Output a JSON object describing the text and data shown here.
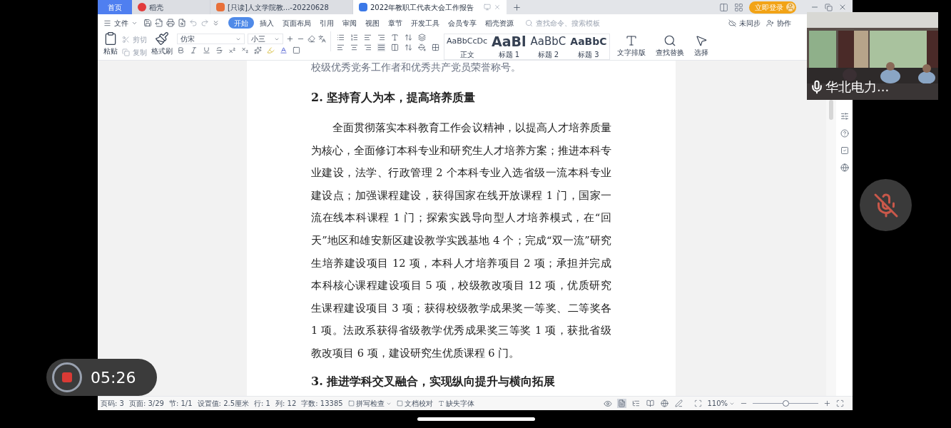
{
  "app_tabs": [
    {
      "label": "首页",
      "kind": "home",
      "selected": false
    },
    {
      "label": "稻壳",
      "kind": "app",
      "selected": false
    },
    {
      "label": "[只读]人文学院教...-20220628",
      "kind": "slides",
      "selected": false
    },
    {
      "label": "2022年教职工代表大会工作报告",
      "kind": "doc",
      "selected": true
    }
  ],
  "login_button": "立即登录",
  "menu": {
    "file": "文件",
    "tabs": [
      {
        "label": "开始",
        "selected": true
      },
      {
        "label": "插入",
        "selected": false
      },
      {
        "label": "页面布局",
        "selected": false
      },
      {
        "label": "引用",
        "selected": false
      },
      {
        "label": "审阅",
        "selected": false
      },
      {
        "label": "视图",
        "selected": false
      },
      {
        "label": "章节",
        "selected": false
      },
      {
        "label": "开发工具",
        "selected": false
      },
      {
        "label": "会员专享",
        "selected": false
      },
      {
        "label": "稻壳资源",
        "selected": false
      }
    ],
    "search": {
      "placeholder": "查找命令、搜索模板"
    },
    "sync": "未同步",
    "collab": "协作"
  },
  "ribbon": {
    "paste": "粘贴",
    "cut": {
      "label": "剪切",
      "disabled": true
    },
    "copy": {
      "label": "复制",
      "disabled": true
    },
    "format_painter": "格式刷",
    "font": "仿宋",
    "size": "小三",
    "styles": [
      {
        "preview": "AaBbCcDc",
        "label": "正文",
        "kind": "normal"
      },
      {
        "preview": "AaBl",
        "label": "标题 1",
        "kind": "h1"
      },
      {
        "preview": "AaBbC",
        "label": "标题 2",
        "kind": "h2"
      },
      {
        "preview": "AaBbC",
        "label": "标题 3",
        "kind": "h3"
      }
    ],
    "text_layout": "文字排版",
    "find_replace": "查找替换",
    "select": "选择"
  },
  "document": {
    "blocks": [
      {
        "kind": "clipped",
        "text": "校级优秀党务工作者和优秀共产党员荣誉称号。"
      },
      {
        "kind": "heading",
        "text": "2. 坚持育人为本，提高培养质量"
      },
      {
        "kind": "body",
        "text": "全面贯彻落实本科教育工作会议精神，以提高人才培养质量为核心，全面修订本科专业和研究生人才培养方案；推进本科专业建设，法学、行政管理 2 个本科专业入选省级一流本科专业建设点；加强课程建设，获得国家在线开放课程 1 门，国家一流在线本科课程 1 门；探索实践导向型人才培养模式，在“回天”地区和雄安新区建设教学实践基地 4 个；完成“双一流”研究生培养建设项目 12 项，本科人才培养项目 2 项；承担并完成本科核心课程建设项目 5 项，校级教改项目 12 项，优质研究生课程建设项目 3 项；获得校级教学成果奖一等奖、二等奖各 1 项。法政系获得省级教学优秀成果奖三等奖 1 项，获批省级教改项目 6 项，建设研究生优质课程 6 门。"
      },
      {
        "kind": "heading",
        "text": "3. 推进学科交叉融合，实现纵向提升与横向拓展"
      }
    ]
  },
  "status_bar": {
    "items": [
      "页码: 3",
      "页面: 3/29",
      "节: 1/1",
      "设置值: 2.5厘米",
      "行: 1",
      "列: 12",
      "字数: 13385"
    ],
    "spell_check": "拼写检查",
    "proofread": "文档校对",
    "missing_fonts": "缺失字体",
    "view_modes": [
      {
        "kind": "page",
        "selected": true
      },
      {
        "kind": "outline",
        "selected": false
      },
      {
        "kind": "reading",
        "selected": false
      },
      {
        "kind": "web",
        "selected": false
      },
      {
        "kind": "write",
        "selected": false
      }
    ],
    "zoom": "110%",
    "zoom_slider": {
      "level": 0.5
    }
  },
  "video_tile": {
    "kind": "picture",
    "name": "华北电力..."
  },
  "mic": {
    "muted": true
  },
  "recording": {
    "time": "05:26"
  }
}
